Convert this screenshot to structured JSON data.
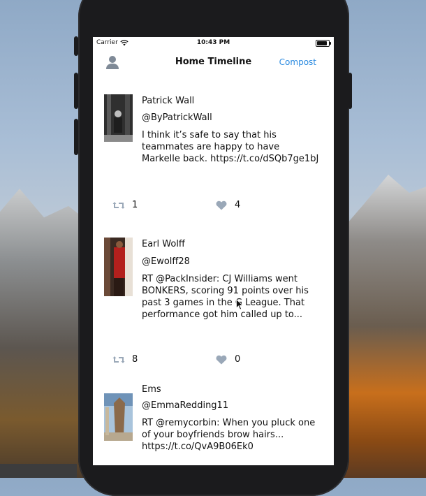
{
  "status_bar": {
    "carrier": "Carrier",
    "time": "10:43 PM",
    "battery_level": 0.85
  },
  "nav": {
    "title": "Home Timeline",
    "compose_label": "Compost"
  },
  "tweets": [
    {
      "name": "Patrick Wall",
      "handle": "@ByPatrickWall",
      "text": "I think it’s safe to say that his teammates are happy to have Markelle back. https://t.co/dSQb7ge1bJ",
      "retweets": "1",
      "likes": "4"
    },
    {
      "name": "Earl Wolff",
      "handle": "@Ewolff28",
      "text": "RT @PackInsider: CJ Williams went BONKERS, scoring 91 points over  his past 3 games in the G League. That performance got him called up to...",
      "retweets": "8",
      "likes": "0"
    },
    {
      "name": "Ems",
      "handle": "@EmmaRedding11",
      "text": "RT @remycorbin: When you pluck one of your boyfriends brow hairs... https://t.co/QvA9B06Ek0",
      "retweets": "",
      "likes": ""
    }
  ],
  "colors": {
    "accent": "#2a8ae0",
    "icon_gray": "#9aa8b8"
  },
  "icons": {
    "profile": "person-icon",
    "retweet": "retweet-icon",
    "like": "heart-icon",
    "wifi": "wifi-icon",
    "battery": "battery-icon"
  }
}
